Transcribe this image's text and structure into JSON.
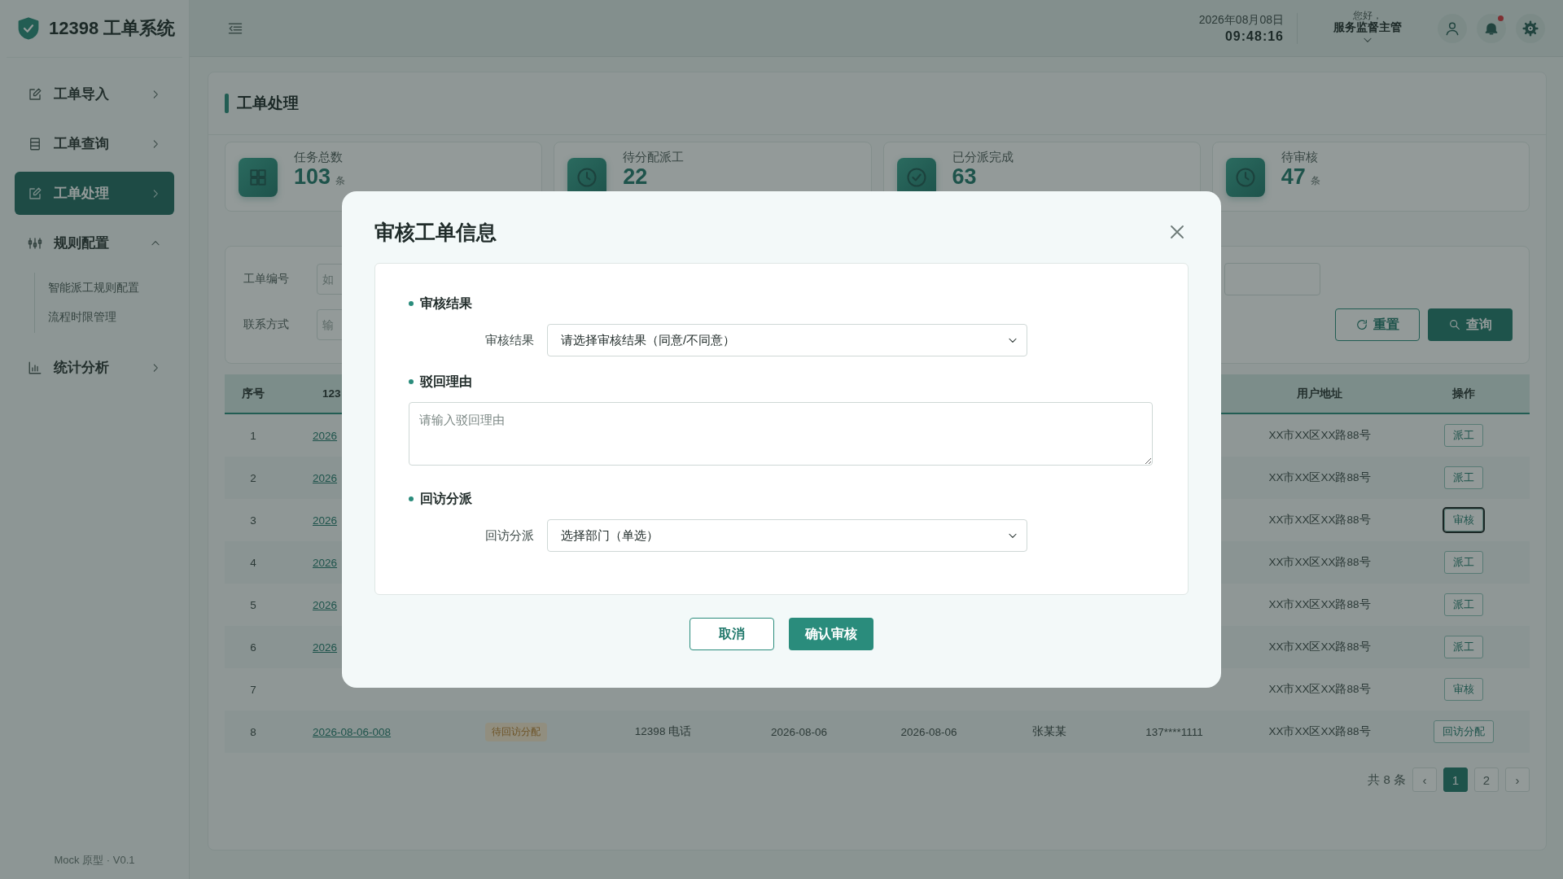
{
  "sidebar": {
    "logo_text": "12398 工单系统",
    "items": [
      {
        "label": "工单导入",
        "selected": false,
        "expanded": false
      },
      {
        "label": "工单查询",
        "selected": false,
        "expanded": false
      },
      {
        "label": "工单处理",
        "selected": true,
        "expanded": false
      },
      {
        "label": "规则配置",
        "selected": false,
        "expanded": true,
        "children": [
          {
            "label": "智能派工规则配置"
          },
          {
            "label": "流程时限管理"
          }
        ]
      },
      {
        "label": "统计分析",
        "selected": false,
        "expanded": false
      }
    ],
    "footer": "Mock 原型 · V0.1"
  },
  "header": {
    "date": "2026年08月08日",
    "time": "09:48:16",
    "greeting": "您好，",
    "user": "服务监督主管",
    "unread": true
  },
  "page": {
    "title": "工单处理",
    "stats": [
      {
        "label": "任务总数",
        "value": "103",
        "unit": "条"
      },
      {
        "label": "待分配派工",
        "value": "22"
      },
      {
        "label": "已分派完成",
        "value": "63"
      },
      {
        "label": "待审核",
        "value": "47",
        "unit": "条"
      }
    ],
    "filters": [
      {
        "label": "工单编号",
        "placeholder": "如"
      },
      {
        "label": "联系方式",
        "placeholder": "输"
      }
    ],
    "filter_buttons": [
      {
        "label": "重置",
        "kind": "reset"
      },
      {
        "label": "查询",
        "kind": "search"
      }
    ]
  },
  "table": {
    "columns": {
      "index": "序号",
      "column_2": "123",
      "address": "用户地址",
      "action": "操作"
    },
    "rows": [
      {
        "index": "1",
        "column_2": "2026",
        "address": "XX市XX区XX路88号",
        "action": {
          "label": "派工",
          "focused": false
        }
      },
      {
        "index": "2",
        "column_2": "2026",
        "address": "XX市XX区XX路88号",
        "action": {
          "label": "派工",
          "focused": false
        }
      },
      {
        "index": "3",
        "column_2": "2026",
        "address": "XX市XX区XX路88号",
        "action": {
          "label": "审核",
          "focused": true
        }
      },
      {
        "index": "4",
        "column_2": "2026",
        "address": "XX市XX区XX路88号",
        "action": {
          "label": "派工",
          "focused": false
        }
      },
      {
        "index": "5",
        "column_2": "2026",
        "address": "XX市XX区XX路88号",
        "action": {
          "label": "派工",
          "focused": false
        }
      },
      {
        "index": "6",
        "column_2": "2026",
        "address": "XX市XX区XX路88号",
        "action": {
          "label": "派工",
          "focused": false
        }
      },
      {
        "index": "7",
        "address": "XX市XX区XX路88号",
        "action": {
          "label": "审核",
          "focused": false
        }
      },
      {
        "index": "8",
        "column_2": "2026-08-06-008",
        "column_3": "待回访分配",
        "column_4": "12398 电话",
        "column_5": "2026-08-06",
        "column_6": "2026-08-06",
        "column_7": "张某某",
        "column_8": "137****1111",
        "address": "XX市XX区XX路88号",
        "action": {
          "label": "回访分配",
          "focused": false
        }
      }
    ]
  },
  "pagination": {
    "total": "共 8 条",
    "prev": "‹",
    "next": "›",
    "pages": [
      {
        "label": "1",
        "selected": true
      },
      {
        "label": "2",
        "selected": false
      }
    ]
  },
  "dialog": {
    "title": "审核工单信息",
    "sections": [
      {
        "kind": "select",
        "heading": "审核结果",
        "label": "审核结果",
        "value": "请选择审核结果（同意/不同意）"
      },
      {
        "kind": "textarea",
        "heading": "驳回理由",
        "placeholder": "请输入驳回理由"
      },
      {
        "kind": "select",
        "heading": "回访分派",
        "label": "回访分派",
        "value": "选择部门（单选）"
      }
    ],
    "buttons": [
      {
        "label": "取消",
        "kind": "secondary"
      },
      {
        "label": "确认审核",
        "kind": "primary"
      }
    ]
  }
}
